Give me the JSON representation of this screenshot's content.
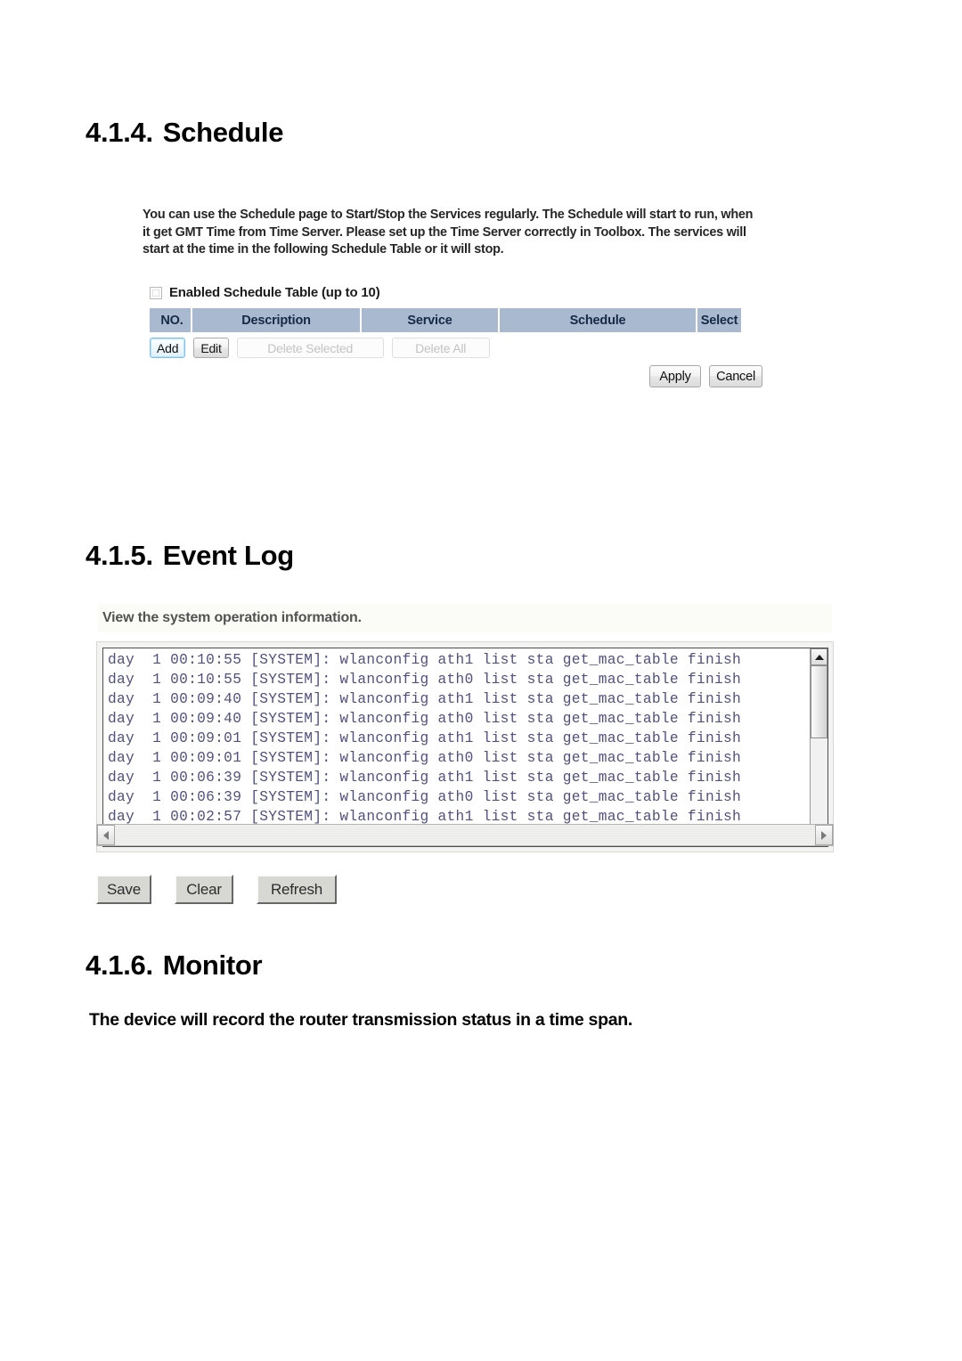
{
  "document": {
    "sections": [
      {
        "number": "4.1.4.",
        "title": "Schedule"
      },
      {
        "number": "4.1.5.",
        "title": "Event Log"
      },
      {
        "number": "4.1.6.",
        "title": "Monitor"
      }
    ]
  },
  "schedule": {
    "description": "You can use the Schedule page to Start/Stop the Services regularly. The Schedule will start to run, when it get GMT Time from Time Server. Please set up the Time Server correctly in Toolbox. The services will start at the time in the following Schedule Table or it will stop.",
    "enable_label": "Enabled Schedule Table (up to 10)",
    "enable_checked": false,
    "table": {
      "columns": [
        "NO.",
        "Description",
        "Service",
        "Schedule",
        "Select"
      ],
      "rows": []
    },
    "buttons": {
      "add": "Add",
      "edit": "Edit",
      "delete_selected": "Delete Selected",
      "delete_all": "Delete All",
      "apply": "Apply",
      "cancel": "Cancel"
    },
    "header_color": "#a9b9cf",
    "header_text_color": "#152a46"
  },
  "event_log": {
    "description": "View the system operation information.",
    "lines": [
      "day  1 00:10:55 [SYSTEM]: wlanconfig ath1 list sta get_mac_table finish",
      "day  1 00:10:55 [SYSTEM]: wlanconfig ath0 list sta get_mac_table finish",
      "day  1 00:09:40 [SYSTEM]: wlanconfig ath1 list sta get_mac_table finish",
      "day  1 00:09:40 [SYSTEM]: wlanconfig ath0 list sta get_mac_table finish",
      "day  1 00:09:01 [SYSTEM]: wlanconfig ath1 list sta get_mac_table finish",
      "day  1 00:09:01 [SYSTEM]: wlanconfig ath0 list sta get_mac_table finish",
      "day  1 00:06:39 [SYSTEM]: wlanconfig ath1 list sta get_mac_table finish",
      "day  1 00:06:39 [SYSTEM]: wlanconfig ath0 list sta get_mac_table finish",
      "day  1 00:02:57 [SYSTEM]: wlanconfig ath1 list sta get_mac_table finish"
    ],
    "buttons": {
      "save": "Save",
      "clear": "Clear",
      "refresh": "Refresh"
    },
    "text_color": "#2a2a62"
  },
  "monitor": {
    "description": "The device will record the router transmission status in a time span."
  }
}
